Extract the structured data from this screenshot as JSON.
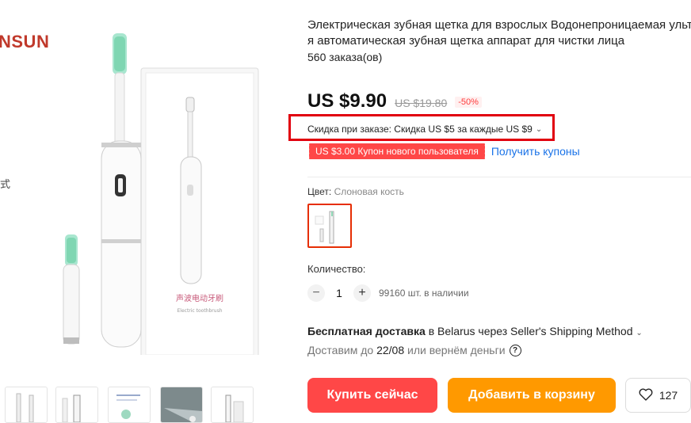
{
  "brand": {
    "text": "NSUN"
  },
  "side_text": "式",
  "product": {
    "title_line1": "Электрическая зубная щетка для взрослых Водонепроницаемая ультра",
    "title_line2": "я автоматическая зубная щетка аппарат для чистки лица",
    "orders": "560 заказа(ов)"
  },
  "price": {
    "current": "US $9.90",
    "original": "US $19.80",
    "discount": "-50%"
  },
  "promo": {
    "text": "Скидка при заказе: Скидка US $5 за каждые US $9",
    "chevron": "⌄"
  },
  "coupon": {
    "tag": "US $3.00 Купон нового пользователя",
    "link": "Получить купоны"
  },
  "color": {
    "label": "Цвет: ",
    "value": "Слоновая кость"
  },
  "quantity": {
    "label": "Количество:",
    "minus": "−",
    "value": "1",
    "plus": "+",
    "stock": "99160 шт. в наличии"
  },
  "shipping": {
    "bold": "Бесплатная доставка",
    "rest": " в Belarus через Seller's Shipping Method",
    "chevron": "⌄",
    "deliver_prefix": "Доставим до ",
    "deliver_date": "22/08",
    "deliver_suffix": " или вернём деньги",
    "help": "?"
  },
  "actions": {
    "buy_now": "Купить сейчас",
    "add_to_cart": "Добавить в корзину",
    "wishlist_count": "127"
  },
  "package": {
    "box_text": "声波电动牙刷",
    "box_subtext": "Electric toothbrush"
  },
  "colors": {
    "accent_red": "#ff4747",
    "accent_orange": "#ff9900",
    "promo_border": "#e1000f",
    "link_blue": "#1a73e8"
  }
}
